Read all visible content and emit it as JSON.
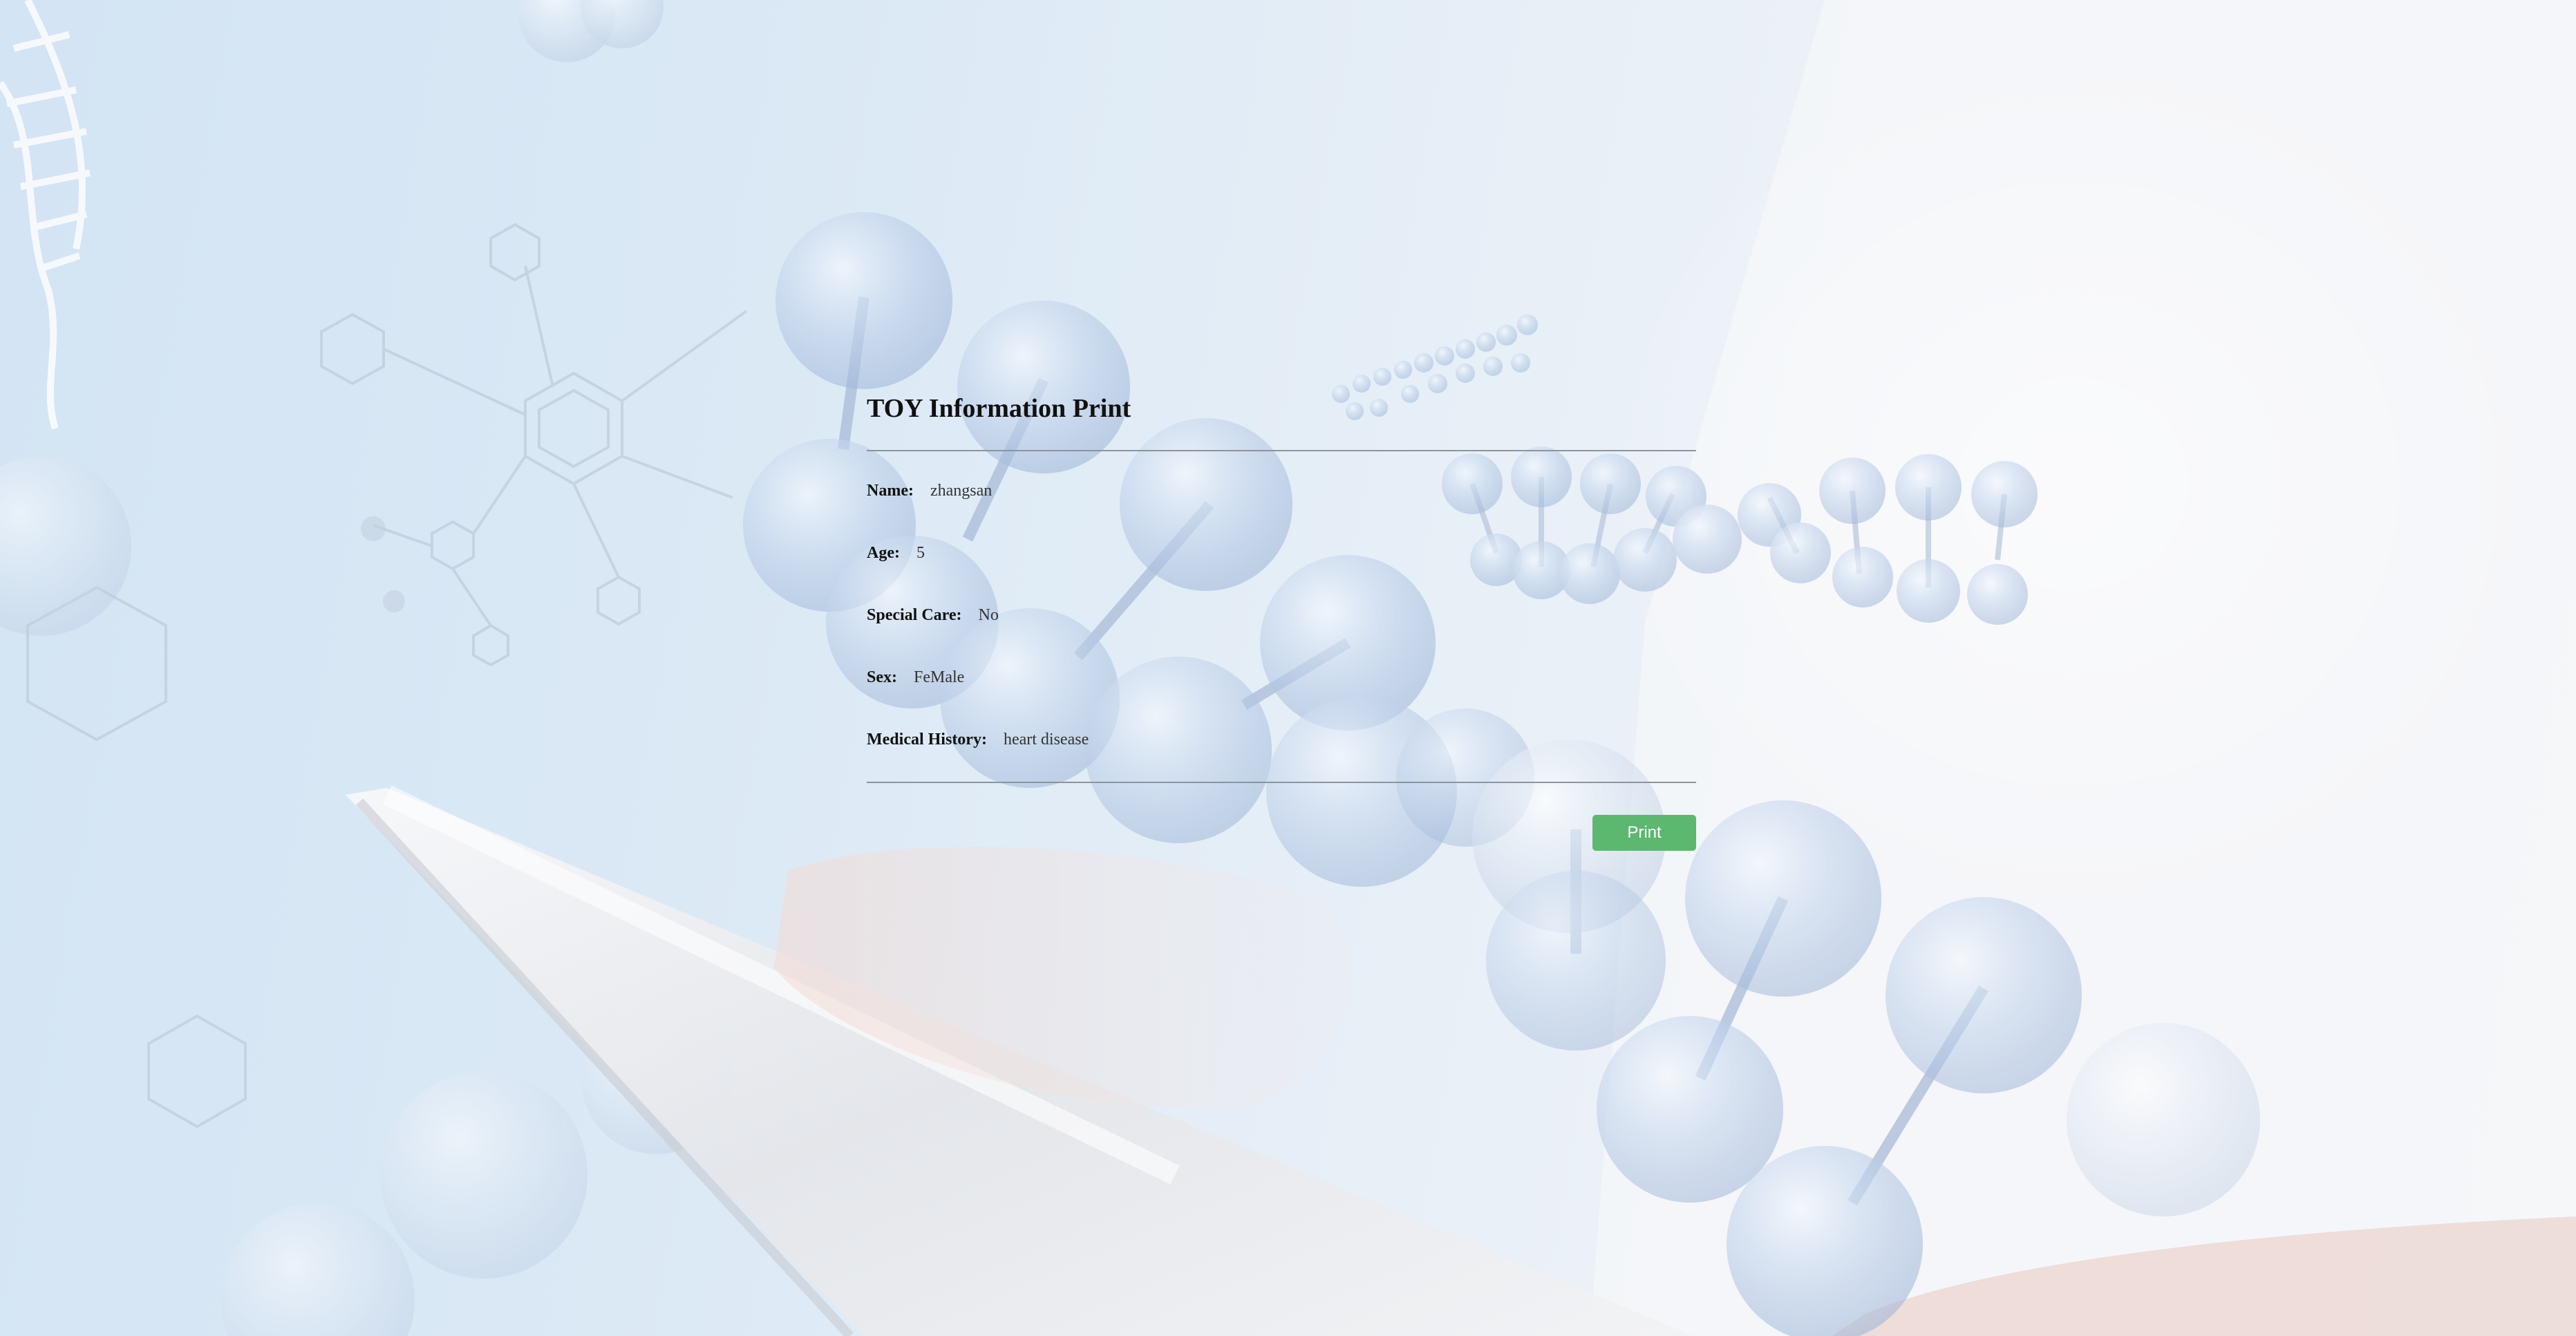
{
  "page": {
    "title": "TOY Information Print"
  },
  "fields": [
    {
      "label": "Name:",
      "value": "zhangsan"
    },
    {
      "label": "Age:",
      "value": "5"
    },
    {
      "label": "Special Care:",
      "value": "No"
    },
    {
      "label": "Sex:",
      "value": "FeMale"
    },
    {
      "label": "Medical History:",
      "value": "heart disease"
    }
  ],
  "actions": {
    "print_label": "Print"
  },
  "colors": {
    "print_button": "#5cb86f",
    "divider": "#8e949c",
    "background_left": "#d3e4f4",
    "background_right": "#f5f5f8"
  },
  "background": {
    "icon": "molecule-background-image"
  }
}
